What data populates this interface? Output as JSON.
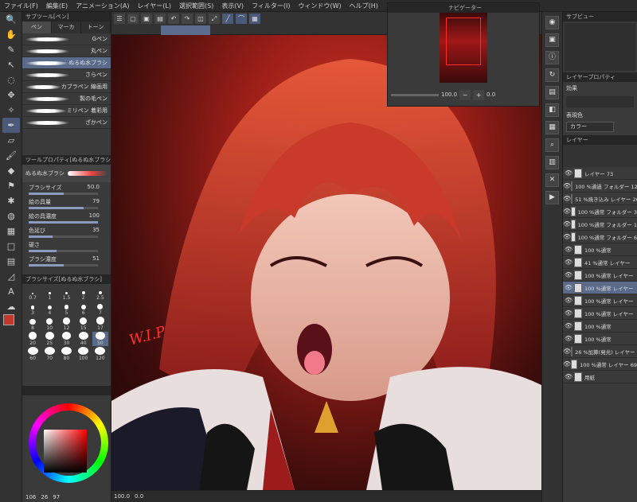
{
  "menu": [
    "ファイル(F)",
    "編集(E)",
    "アニメーション(A)",
    "レイヤー(L)",
    "選択範囲(S)",
    "表示(V)",
    "フィルター(I)",
    "ウィンドウ(W)",
    "ヘルプ(H)"
  ],
  "subtool": {
    "title": "サブツール[ペン]",
    "tabs": [
      "ペン",
      "マーカ",
      "トーン"
    ],
    "brushes": [
      {
        "name": "Gペン",
        "selected": false
      },
      {
        "name": "丸ペン",
        "selected": false
      },
      {
        "name": "ぬるぬ水ブラシ",
        "selected": true
      },
      {
        "name": "さらペン",
        "selected": false
      },
      {
        "name": "カブラペン 線画用",
        "selected": false
      },
      {
        "name": "製の毛ペン",
        "selected": false
      },
      {
        "name": "ミリペン 着彩用",
        "selected": false
      },
      {
        "name": "ざかペン",
        "selected": false
      }
    ]
  },
  "toolprop": {
    "title": "ツールプロパティ[ぬるぬ水ブラシ]",
    "preset": "ぬるぬ水ブラシ",
    "props": [
      {
        "label": "ブラシサイズ",
        "value": "50.0",
        "fill": 0.5
      },
      {
        "label": "絵の具量",
        "value": "79",
        "fill": 0.79
      },
      {
        "label": "絵の具濃度",
        "value": "100",
        "fill": 1.0
      },
      {
        "label": "色延び",
        "value": "35",
        "fill": 0.35
      },
      {
        "label": "硬さ",
        "value": "",
        "fill": 0.4
      },
      {
        "label": "ブラシ濃度",
        "value": "51",
        "fill": 0.51
      }
    ]
  },
  "brushsize": {
    "title": "ブラシサイズ[ぬるぬ水ブラシ]",
    "sizes": [
      "0.7",
      "1",
      "1.5",
      "2",
      "2.5",
      "3",
      "4",
      "5",
      "6",
      "7",
      "8",
      "10",
      "12",
      "15",
      "17",
      "20",
      "25",
      "30",
      "40",
      "50",
      "60",
      "70",
      "80",
      "100",
      "120"
    ],
    "selected": "50"
  },
  "color": {
    "main": "#c0392b",
    "sub": "#5b6ee1",
    "readout": [
      "106",
      "26",
      "97"
    ]
  },
  "canvas": {
    "zoom": "100.0",
    "angle": "0.0",
    "doc_tab_label": ""
  },
  "navigator": {
    "title": "ナビゲーター",
    "zoom": "100.0",
    "angle": "0.0"
  },
  "right": {
    "subview_title": "サブビュー",
    "layerprop_title": "レイヤープロパティ",
    "effect_label": "効果",
    "expression_label": "表現色",
    "expression_value": "カラー",
    "layer_title": "レイヤー",
    "layers": [
      {
        "name": "レイヤー 73",
        "selected": false
      },
      {
        "name": "100 %通過 フォルダー 12",
        "selected": false
      },
      {
        "name": "51 %焼き込み レイヤー 26",
        "selected": false
      },
      {
        "name": "100 %通常 フォルダー 3",
        "selected": false
      },
      {
        "name": "100 %通常 フォルダー 1",
        "selected": false
      },
      {
        "name": "100 %通常 フォルダー 6",
        "selected": false
      },
      {
        "name": "100 %通常",
        "selected": false
      },
      {
        "name": "41 %通常 レイヤー",
        "selected": false
      },
      {
        "name": "100 %通常 レイヤー",
        "selected": false
      },
      {
        "name": "100 %通常 レイヤー",
        "selected": true
      },
      {
        "name": "100 %通常 レイヤー",
        "selected": false
      },
      {
        "name": "100 %通常 レイヤー",
        "selected": false
      },
      {
        "name": "100 %通常",
        "selected": false
      },
      {
        "name": "100 %通常",
        "selected": false
      },
      {
        "name": "26 %加算(発光) レイヤー 69",
        "selected": false
      },
      {
        "name": "100 %通常 レイヤー 69",
        "selected": false
      },
      {
        "name": "用紙",
        "selected": false
      }
    ]
  },
  "watermark": "W.I.P"
}
